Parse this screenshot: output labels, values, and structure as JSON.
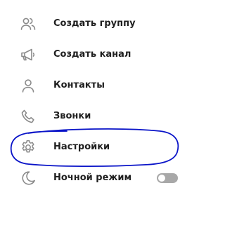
{
  "menu": {
    "items": [
      {
        "label": "Создать группу",
        "icon": "group-icon"
      },
      {
        "label": "Создать канал",
        "icon": "megaphone-icon"
      },
      {
        "label": "Контакты",
        "icon": "person-icon"
      },
      {
        "label": "Звонки",
        "icon": "phone-icon"
      },
      {
        "label": "Настройки",
        "icon": "gear-icon"
      },
      {
        "label": "Ночной режим",
        "icon": "moon-icon"
      }
    ],
    "night_mode_enabled": false
  },
  "colors": {
    "icon": "#8a8a8a",
    "text": "#1f1f1f",
    "toggle_track": "#a8a8a8",
    "annotation": "#0a14c8"
  }
}
